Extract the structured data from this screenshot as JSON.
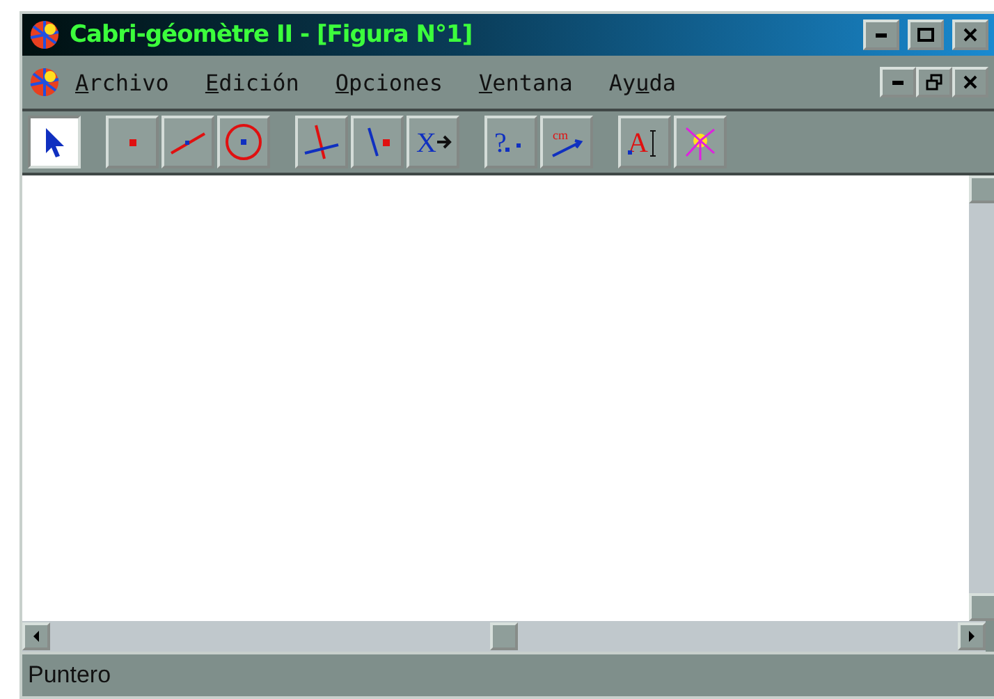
{
  "window": {
    "title": "Cabri-géomètre II - [Figura N°1]"
  },
  "menu": [
    {
      "key": "A",
      "post": "rchivo"
    },
    {
      "key": "E",
      "post": "dición"
    },
    {
      "key": "O",
      "post": "pciones"
    },
    {
      "key": "V",
      "post": "entana"
    },
    {
      "pre": "Ay",
      "key": "u",
      "post": "da"
    }
  ],
  "toolbar": [
    [
      {
        "kind": "pointer",
        "selected": true
      }
    ],
    [
      {
        "kind": "point",
        "selected": false
      },
      {
        "kind": "line",
        "selected": false
      },
      {
        "kind": "circle",
        "selected": false
      }
    ],
    [
      {
        "kind": "intersection",
        "selected": false
      },
      {
        "kind": "point-on",
        "selected": false
      },
      {
        "kind": "transform",
        "selected": false,
        "glyph": "X"
      }
    ],
    [
      {
        "kind": "check",
        "selected": false,
        "glyph": "?"
      },
      {
        "kind": "measure",
        "selected": false,
        "glyph": "cm"
      }
    ],
    [
      {
        "kind": "text",
        "selected": false,
        "glyph": "A"
      },
      {
        "kind": "display",
        "selected": false
      }
    ]
  ],
  "status_bar": "Puntero"
}
